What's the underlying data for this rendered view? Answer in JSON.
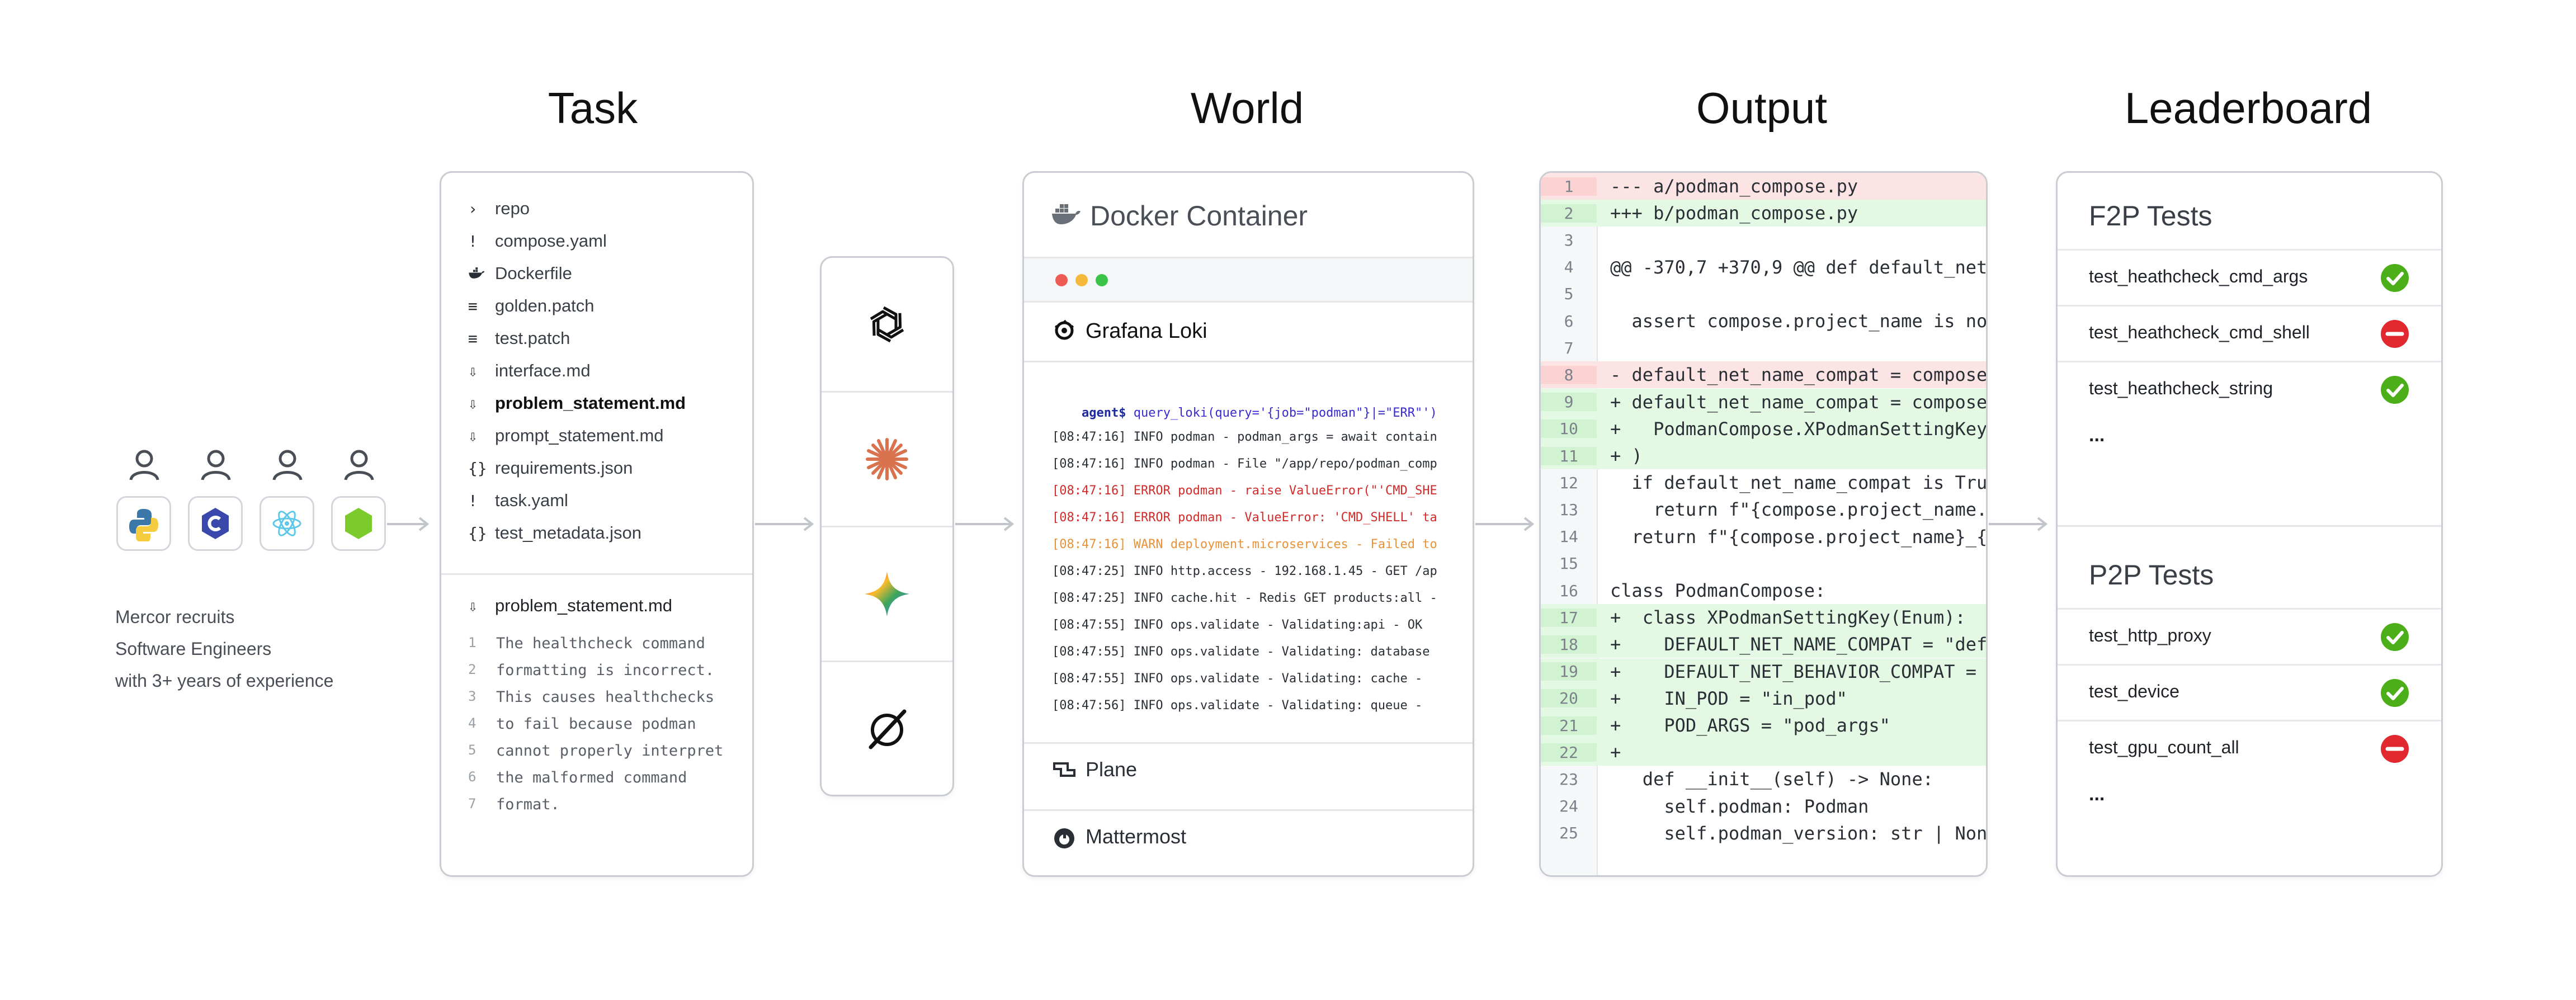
{
  "headings": {
    "task": "Task",
    "world": "World",
    "output": "Output",
    "leaderboard": "Leaderboard"
  },
  "left": {
    "people_icons": [
      "person-icon",
      "person-icon",
      "person-icon",
      "person-icon"
    ],
    "languages": [
      "python-icon",
      "c-icon",
      "react-icon",
      "nodejs-icon"
    ],
    "caption": [
      "Mercor recruits",
      "Software Engineers",
      "with 3+ years of experience"
    ]
  },
  "task": {
    "files": [
      {
        "icon": "chevron-right-icon",
        "glyph": "›",
        "name": "repo",
        "bold": false
      },
      {
        "icon": "exclamation-icon",
        "glyph": "!",
        "name": "compose.yaml",
        "bold": false
      },
      {
        "icon": "docker-icon",
        "glyph": "",
        "name": "Dockerfile",
        "bold": false
      },
      {
        "icon": "lines-icon",
        "glyph": "≡",
        "name": "golden.patch",
        "bold": false
      },
      {
        "icon": "lines-icon",
        "glyph": "≡",
        "name": "test.patch",
        "bold": false
      },
      {
        "icon": "markdown-icon",
        "glyph": "⇩",
        "name": "interface.md",
        "bold": false
      },
      {
        "icon": "markdown-icon",
        "glyph": "⇩",
        "name": "problem_statement.md",
        "bold": true
      },
      {
        "icon": "markdown-icon",
        "glyph": "⇩",
        "name": "prompt_statement.md",
        "bold": false
      },
      {
        "icon": "json-icon",
        "glyph": "{}",
        "name": "requirements.json",
        "bold": false
      },
      {
        "icon": "exclamation-icon",
        "glyph": "!",
        "name": "task.yaml",
        "bold": false
      },
      {
        "icon": "json-icon",
        "glyph": "{}",
        "name": "test_metadata.json",
        "bold": false
      }
    ],
    "preview_file": {
      "icon": "markdown-icon",
      "glyph": "⇩",
      "name": "problem_statement.md"
    },
    "preview_lines": [
      "The healthcheck command",
      "formatting is incorrect.",
      "This causes healthchecks",
      "to fail because podman",
      "cannot properly interpret",
      "the malformed command",
      "format."
    ]
  },
  "models": [
    "openai-icon",
    "anthropic-icon",
    "gemini-icon",
    "xai-grok-icon"
  ],
  "world": {
    "title": "Docker Container",
    "app": "Grafana Loki",
    "prompt": "agent$",
    "query": " query_loki(query='{job=\"podman\"}|=\"ERR\"')",
    "logs": [
      {
        "text": "[08:47:16] INFO podman - podman_args = await contain",
        "level": "info"
      },
      {
        "text": "[08:47:16] INFO podman - File \"/app/repo/podman_comp",
        "level": "info"
      },
      {
        "text": "[08:47:16] ERROR podman - raise ValueError(\"'CMD_SHE",
        "level": "err"
      },
      {
        "text": "[08:47:16] ERROR podman - ValueError: 'CMD_SHELL' ta",
        "level": "err"
      },
      {
        "text": "[08:47:16] WARN deployment.microservices - Failed to",
        "level": "warn"
      },
      {
        "text": "[08:47:25] INFO http.access - 192.168.1.45 - GET /ap",
        "level": "info"
      },
      {
        "text": "[08:47:25] INFO cache.hit - Redis GET products:all -",
        "level": "info"
      },
      {
        "text": "[08:47:55] INFO ops.validate - Validating:api - OK",
        "level": "info"
      },
      {
        "text": "[08:47:55] INFO ops.validate - Validating: database",
        "level": "info"
      },
      {
        "text": "[08:47:55] INFO ops.validate - Validating: cache -",
        "level": "info"
      },
      {
        "text": "[08:47:56] INFO ops.validate - Validating: queue -",
        "level": "info"
      }
    ],
    "apps_below": [
      "Plane",
      "Mattermost"
    ]
  },
  "output": {
    "diff": [
      {
        "n": "1",
        "t": "--- a/podman_compose.py",
        "k": "del"
      },
      {
        "n": "2",
        "t": "+++ b/podman_compose.py",
        "k": "add"
      },
      {
        "n": "3",
        "t": "",
        "k": "ctx"
      },
      {
        "n": "4",
        "t": "@@ -370,7 +370,9 @@ def default_net",
        "k": "ctx"
      },
      {
        "n": "5",
        "t": "",
        "k": "ctx"
      },
      {
        "n": "6",
        "t": "  assert compose.project_name is no",
        "k": "ctx"
      },
      {
        "n": "7",
        "t": "",
        "k": "ctx"
      },
      {
        "n": "8",
        "t": "- default_net_name_compat = compose",
        "k": "del"
      },
      {
        "n": "9",
        "t": "+ default_net_name_compat = compose",
        "k": "add"
      },
      {
        "n": "10",
        "t": "+   PodmanCompose.XPodmanSettingKey",
        "k": "add"
      },
      {
        "n": "11",
        "t": "+ )",
        "k": "add"
      },
      {
        "n": "12",
        "t": "  if default_net_name_compat is Tru",
        "k": "ctx"
      },
      {
        "n": "13",
        "t": "    return f\"{compose.project_name.",
        "k": "ctx"
      },
      {
        "n": "14",
        "t": "  return f\"{compose.project_name}_{",
        "k": "ctx"
      },
      {
        "n": "15",
        "t": "",
        "k": "ctx"
      },
      {
        "n": "16",
        "t": "class PodmanCompose:",
        "k": "ctx"
      },
      {
        "n": "17",
        "t": "+  class XPodmanSettingKey(Enum):",
        "k": "add"
      },
      {
        "n": "18",
        "t": "+    DEFAULT_NET_NAME_COMPAT = \"def",
        "k": "add"
      },
      {
        "n": "19",
        "t": "+    DEFAULT_NET_BEHAVIOR_COMPAT = ",
        "k": "add"
      },
      {
        "n": "20",
        "t": "+    IN_POD = \"in_pod\"",
        "k": "add"
      },
      {
        "n": "21",
        "t": "+    POD_ARGS = \"pod_args\"",
        "k": "add"
      },
      {
        "n": "22",
        "t": "+",
        "k": "add"
      },
      {
        "n": "23",
        "t": "   def __init__(self) -> None:",
        "k": "ctx"
      },
      {
        "n": "24",
        "t": "     self.podman: Podman",
        "k": "ctx"
      },
      {
        "n": "25",
        "t": "     self.podman_version: str | Non",
        "k": "ctx"
      }
    ]
  },
  "leaderboard": {
    "f2p_title": "F2P Tests",
    "f2p": [
      {
        "name": "test_heathcheck_cmd_args",
        "status": "pass"
      },
      {
        "name": "test_heathcheck_cmd_shell",
        "status": "fail"
      },
      {
        "name": "test_heathcheck_string",
        "status": "pass"
      }
    ],
    "p2p_title": "P2P Tests",
    "p2p": [
      {
        "name": "test_http_proxy",
        "status": "pass"
      },
      {
        "name": "test_device",
        "status": "pass"
      },
      {
        "name": "test_gpu_count_all",
        "status": "fail"
      }
    ],
    "more": "...",
    "colors": {
      "pass": "#4caf1a",
      "fail": "#e0282e"
    }
  }
}
